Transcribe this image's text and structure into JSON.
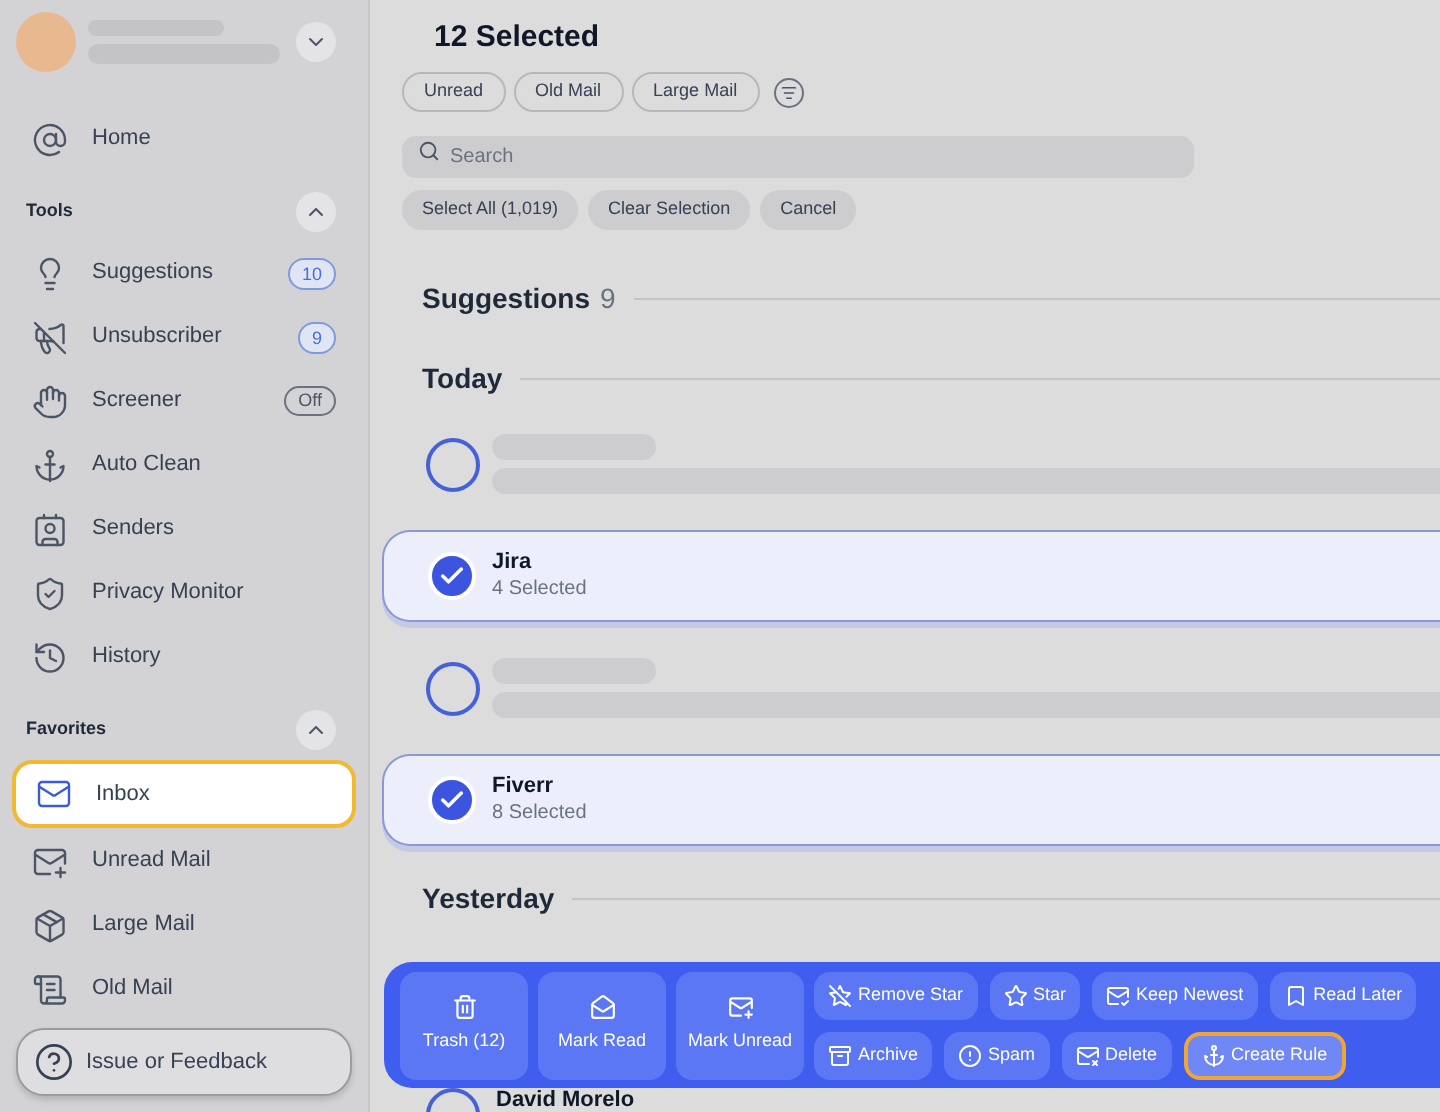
{
  "profile": {
    "expanded": false
  },
  "home": {
    "label": "Home"
  },
  "sections": [
    {
      "title": "Tools",
      "expanded": true,
      "items": [
        {
          "label": "Suggestions",
          "selected": false,
          "badge": {
            "text": "10",
            "kind": "count"
          }
        },
        {
          "label": "Unsubscriber",
          "selected": false,
          "badge": {
            "text": "9",
            "kind": "count"
          }
        },
        {
          "label": "Screener",
          "selected": false,
          "badge": {
            "text": "Off",
            "kind": "status"
          }
        },
        {
          "label": "Auto Clean",
          "selected": false
        },
        {
          "label": "Senders",
          "selected": false
        },
        {
          "label": "Privacy Monitor",
          "selected": false
        },
        {
          "label": "History",
          "selected": false
        }
      ]
    },
    {
      "title": "Favorites",
      "expanded": true,
      "items": [
        {
          "label": "Inbox",
          "selected": true
        },
        {
          "label": "Unread Mail",
          "selected": false
        },
        {
          "label": "Large Mail",
          "selected": false
        },
        {
          "label": "Old Mail",
          "selected": false
        }
      ]
    }
  ],
  "feedback": {
    "label": "Issue or Feedback"
  },
  "header": {
    "title": "12 Selected"
  },
  "filters": [
    "Unread",
    "Old Mail",
    "Large Mail"
  ],
  "search": {
    "placeholder": "Search"
  },
  "selection_buttons": [
    "Select All (1,019)",
    "Clear Selection",
    "Cancel"
  ],
  "groups": [
    {
      "title": "Suggestions",
      "count": "9"
    },
    {
      "title": "Today",
      "rows": [
        {
          "kind": "placeholder",
          "selected": false
        },
        {
          "kind": "sender",
          "name": "Jira",
          "subtitle": "4 Selected",
          "selected": true
        },
        {
          "kind": "placeholder",
          "selected": false
        },
        {
          "kind": "sender",
          "name": "Fiverr",
          "subtitle": "8 Selected",
          "selected": true
        }
      ]
    },
    {
      "title": "Yesterday",
      "rows": [
        {
          "kind": "sender",
          "name": "David Morelo",
          "selected": false
        }
      ]
    }
  ],
  "toolbar": {
    "large": [
      {
        "label": "Trash (12)"
      },
      {
        "label": "Mark Read"
      },
      {
        "label": "Mark Unread"
      }
    ],
    "small": [
      [
        {
          "label": "Remove Star",
          "highlighted": false
        },
        {
          "label": "Star",
          "highlighted": false
        },
        {
          "label": "Keep Newest",
          "highlighted": false
        },
        {
          "label": "Read Later",
          "highlighted": false
        }
      ],
      [
        {
          "label": "Archive",
          "highlighted": false
        },
        {
          "label": "Spam",
          "highlighted": false
        },
        {
          "label": "Delete",
          "highlighted": false
        },
        {
          "label": "Create Rule",
          "highlighted": true
        }
      ]
    ]
  }
}
